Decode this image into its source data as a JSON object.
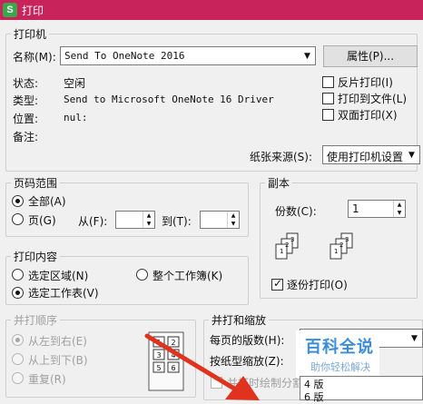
{
  "window": {
    "title": "打印",
    "app_icon_letter": "S"
  },
  "printer": {
    "group_label": "打印机",
    "name_label": "名称(M):",
    "name_value": "Send To OneNote 2016",
    "properties_button": "属性(P)...",
    "status_label": "状态:",
    "status_value": "空闲",
    "type_label": "类型:",
    "type_value": "Send to Microsoft OneNote 16 Driver",
    "location_label": "位置:",
    "location_value": "nul:",
    "comment_label": "备注:",
    "options": [
      {
        "label": "反片打印(I)",
        "checked": false
      },
      {
        "label": "打印到文件(L)",
        "checked": false
      },
      {
        "label": "双面打印(X)",
        "checked": false
      }
    ],
    "paper_source_label": "纸张来源(S):",
    "paper_source_value": "使用打印机设置"
  },
  "page_range": {
    "group_label": "页码范围",
    "all_label": "全部(A)",
    "all_selected": true,
    "pages_label": "页(G)",
    "from_label": "从(F):",
    "to_label": "到(T):",
    "from_value": "",
    "to_value": ""
  },
  "copies": {
    "group_label": "副本",
    "count_label": "份数(C):",
    "count_value": "1",
    "collate_label": "逐份打印(O)",
    "collate_checked": true,
    "collate_stack_1": [
      "1",
      "2",
      "3"
    ],
    "collate_stack_2": [
      "1",
      "2",
      "3"
    ]
  },
  "print_content": {
    "group_label": "打印内容",
    "selection_label": "选定区域(N)",
    "workbook_label": "整个工作簿(K)",
    "sheet_label": "选定工作表(V)",
    "sheet_selected": true
  },
  "print_order": {
    "group_label": "并打顺序",
    "left_to_right": "从左到右(E)",
    "top_to_bottom": "从上到下(B)",
    "repeat": "重复(R)",
    "preview_numbers": [
      "1",
      "2",
      "3",
      "4",
      "5",
      "6"
    ]
  },
  "zoom": {
    "group_label": "并打和缩放",
    "pages_per_sheet_label": "每页的版数(H):",
    "scale_to_paper_label": "按纸型缩放(Z):",
    "draw_borders_label": "并打时绘制分割",
    "list_items": [
      "4 版",
      "6 版"
    ]
  },
  "watermark": {
    "main": "百科全说",
    "sub": "助你轻松解决"
  },
  "colors": {
    "titlebar": "#c8245b",
    "arrow": "#e0321e",
    "watermark": "#3b8ddb"
  }
}
